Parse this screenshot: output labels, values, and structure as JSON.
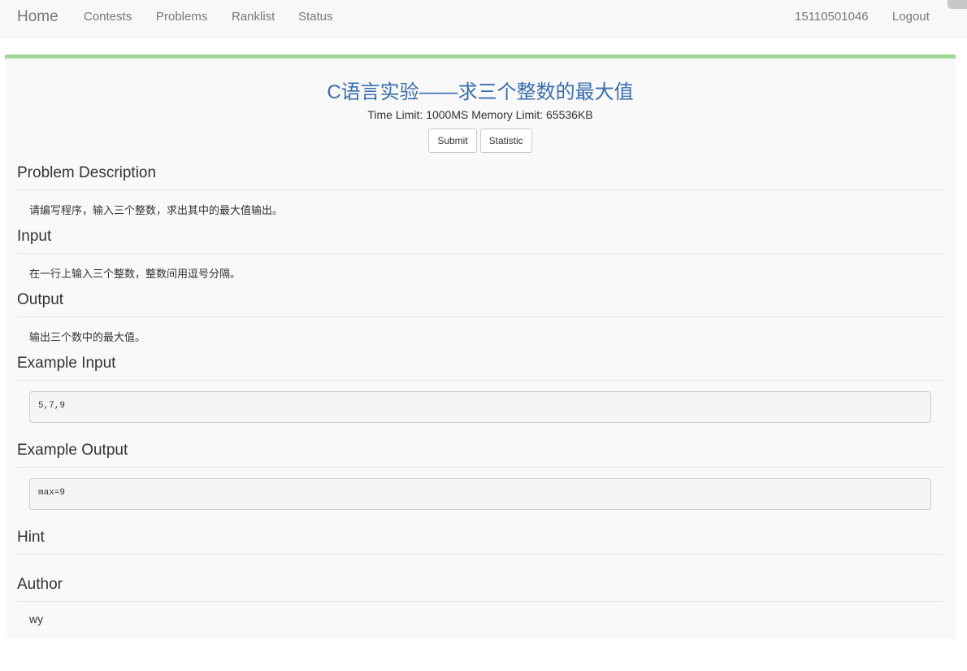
{
  "nav": {
    "brand": "Home",
    "links": [
      "Contests",
      "Problems",
      "Ranklist",
      "Status"
    ],
    "user": "15110501046",
    "logout": "Logout"
  },
  "problem": {
    "title": "C语言实验——求三个整数的最大值",
    "limits": "Time Limit: 1000MS Memory Limit: 65536KB",
    "submit_label": "Submit",
    "statistic_label": "Statistic",
    "sections": {
      "description_heading": "Problem Description",
      "description_text": "请编写程序，输入三个整数，求出其中的最大值输出。",
      "input_heading": "Input",
      "input_text": "在一行上输入三个整数，整数间用逗号分隔。",
      "output_heading": "Output",
      "output_text": "输出三个数中的最大值。",
      "example_input_heading": "Example Input",
      "example_input": "5,7,9",
      "example_output_heading": "Example Output",
      "example_output": "max=9",
      "hint_heading": "Hint",
      "author_heading": "Author",
      "author": "wy"
    }
  },
  "colors": {
    "accent_bar": "#a0d995",
    "title": "#3a6db0",
    "navbar_bg": "#f8f8f8"
  }
}
